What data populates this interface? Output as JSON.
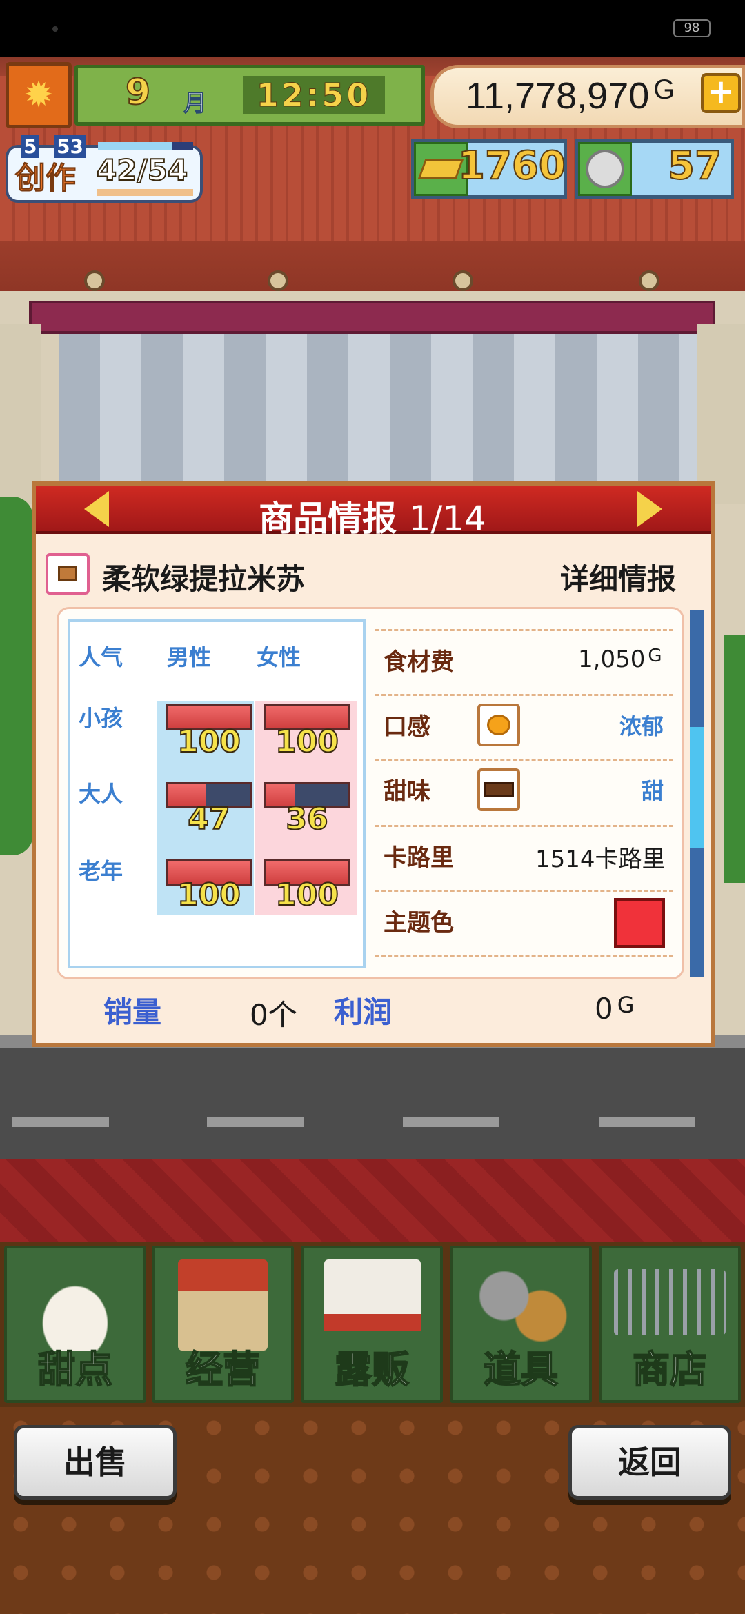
{
  "status_bar": {
    "battery": "98"
  },
  "hud": {
    "month": "9",
    "month_label": "月",
    "time": "12:50",
    "money": "11,778,970",
    "money_unit": "G",
    "plus_label": "+",
    "create": {
      "label": "创作",
      "level_a": "5",
      "level_b": "53",
      "value": "42/54",
      "progress": 0.78
    },
    "gold": "1760",
    "silver": "57"
  },
  "dialog": {
    "title": "商品情报",
    "page": "1/14",
    "item_name": "柔软绿提拉米苏",
    "detail_label": "详细情报",
    "popularity": {
      "header": "人气",
      "male": "男性",
      "female": "女性",
      "rows": [
        {
          "label": "小孩",
          "male": 100,
          "female": 100
        },
        {
          "label": "大人",
          "male": 47,
          "female": 36
        },
        {
          "label": "老年",
          "male": 100,
          "female": 100
        }
      ]
    },
    "attributes": {
      "cost_label": "食材费",
      "cost_value": "1,050",
      "cost_unit": "G",
      "texture_label": "口感",
      "texture_value": "浓郁",
      "sweet_label": "甜味",
      "sweet_value": "甜",
      "calorie_label": "卡路里",
      "calorie_value": "1514卡路里",
      "color_label": "主题色",
      "theme_color": "#f0323a"
    },
    "sales_label": "销量",
    "sales_value": "0个",
    "profit_label": "利润",
    "profit_value": "0",
    "profit_unit": "G"
  },
  "nav": [
    {
      "label": "甜点",
      "icon": "cake-icon"
    },
    {
      "label": "经营",
      "icon": "shop-building-icon"
    },
    {
      "label": "露贩",
      "icon": "food-truck-icon"
    },
    {
      "label": "道具",
      "icon": "gear-bag-icon"
    },
    {
      "label": "商店",
      "icon": "shopping-cart-icon"
    }
  ],
  "buttons": {
    "sell": "出售",
    "back": "返回"
  }
}
